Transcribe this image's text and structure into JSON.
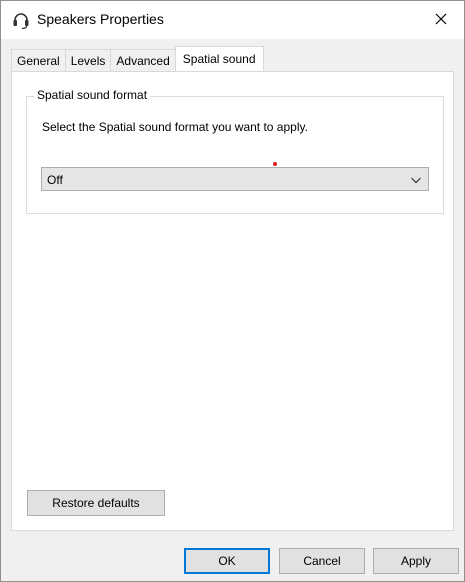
{
  "window": {
    "title": "Speakers Properties",
    "close_icon": "close-icon",
    "app_icon": "headset-speaker-icon"
  },
  "tabs": [
    {
      "label": "General",
      "active": false
    },
    {
      "label": "Levels",
      "active": false
    },
    {
      "label": "Advanced",
      "active": false
    },
    {
      "label": "Spatial sound",
      "active": true
    }
  ],
  "spatial": {
    "group_label": "Spatial sound format",
    "description": "Select the Spatial sound format you want to apply.",
    "select_value": "Off"
  },
  "buttons": {
    "restore": "Restore defaults",
    "ok": "OK",
    "cancel": "Cancel",
    "apply": "Apply"
  },
  "colors": {
    "accent": "#0078d7",
    "dot": "#e11b1b"
  }
}
